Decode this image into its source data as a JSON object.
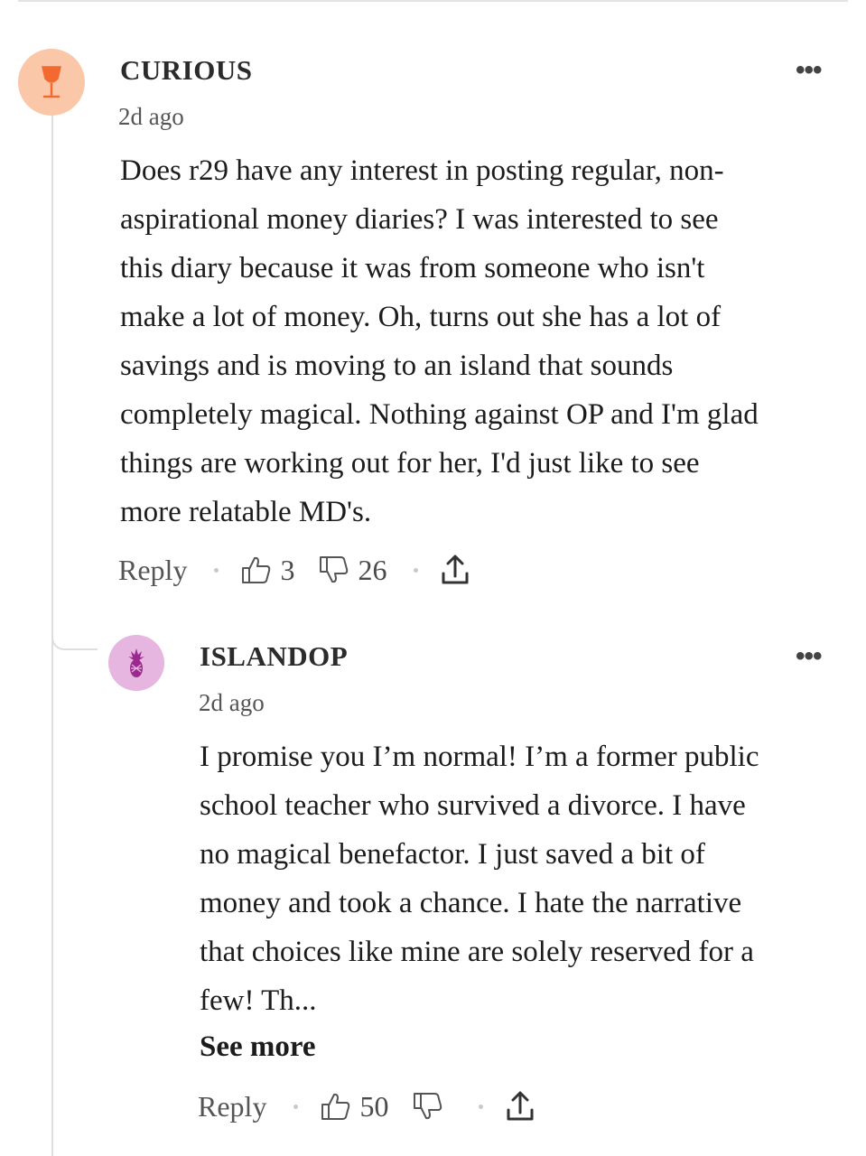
{
  "comments": [
    {
      "username": "CURIOUS",
      "timestamp": "2d ago",
      "avatar_color": "#fac7a8",
      "avatar_icon": "wine-glass-icon",
      "more_label": "•••",
      "lines": [
        "Does r29 have any interest in posting regular, non-",
        "aspirational money diaries? I was interested to see",
        "this diary because it was from someone who isn't",
        "make a lot of money. Oh, turns out she has a lot of",
        "savings and is moving to an island that sounds",
        "completely magical. Nothing against OP and I'm glad",
        "things are working out for her, I'd just like to see",
        "more relatable MD's."
      ],
      "reply_label": "Reply",
      "likes": "3",
      "dislikes": "26"
    },
    {
      "username": "ISLANDOP",
      "timestamp": "2d ago",
      "avatar_color": "#e7b6e0",
      "avatar_icon": "pineapple-icon",
      "more_label": "•••",
      "lines": [
        "I promise you I’m normal! I’m a former public",
        "school teacher who survived a divorce. I have",
        "no magical benefactor. I just saved a bit of",
        "money and took a chance. I hate the narrative",
        "that choices like mine are solely reserved for a",
        "few! Th..."
      ],
      "see_more_label": "See more",
      "reply_label": "Reply",
      "likes": "50",
      "dislikes": ""
    }
  ]
}
